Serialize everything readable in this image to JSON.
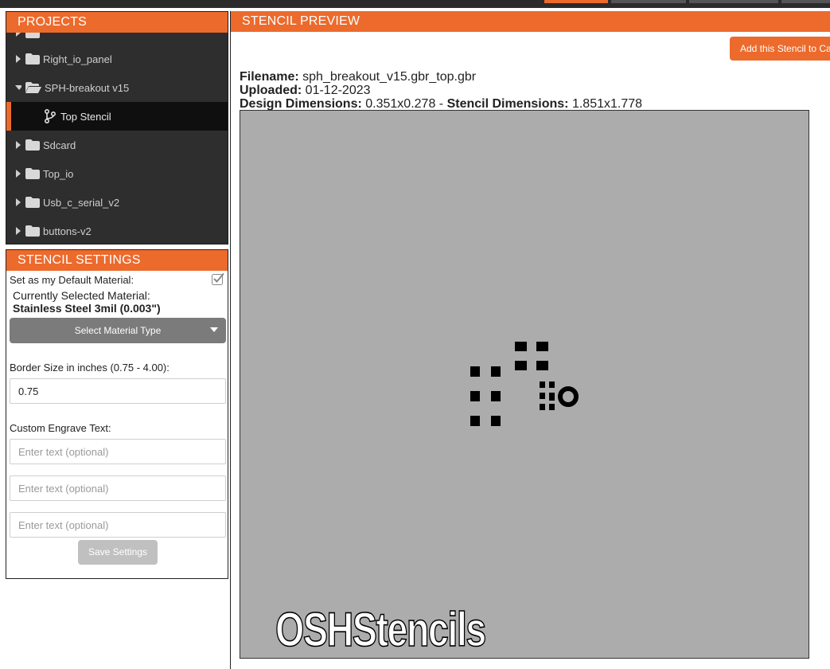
{
  "projects": {
    "title": "PROJECTS",
    "tree": [
      {
        "label": "Right_io_panel",
        "type": "folder",
        "expanded": false
      },
      {
        "label": "SPH-breakout v15",
        "type": "folder",
        "expanded": true
      },
      {
        "label": "Top Stencil",
        "type": "stencil",
        "selected": true
      },
      {
        "label": "Sdcard",
        "type": "folder",
        "expanded": false
      },
      {
        "label": "Top_io",
        "type": "folder",
        "expanded": false
      },
      {
        "label": "Usb_c_serial_v2",
        "type": "folder",
        "expanded": false
      },
      {
        "label": "buttons-v2",
        "type": "folder",
        "expanded": false
      }
    ]
  },
  "settings": {
    "title": "STENCIL SETTINGS",
    "default_material_label": "Set as my Default Material:",
    "default_material_checked": true,
    "current_material_label": "Currently Selected Material:",
    "current_material_value": "Stainless Steel 3mil (0.003\")",
    "select_material_label": "Select Material Type",
    "border_label": "Border Size in inches (0.75 - 4.00):",
    "border_value": "0.75",
    "engrave_label": "Custom Engrave Text:",
    "engrave_placeholder": "Enter text (optional)",
    "save_label": "Save Settings"
  },
  "preview": {
    "title": "STENCIL PREVIEW",
    "add_button_label": "Add this Stencil to Ca",
    "filename_label": "Filename:",
    "filename_value": "sph_breakout_v15.gbr_top.gbr",
    "uploaded_label": "Uploaded:",
    "uploaded_value": "01-12-2023",
    "design_dim_label": "Design Dimensions:",
    "design_dim_value": "0.351x0.278",
    "separator": "-",
    "stencil_dim_label": "Stencil Dimensions:",
    "stencil_dim_value": "1.851x1.778",
    "engraving_text": "OSHStencils"
  },
  "colors": {
    "accent": "#ec6a2c",
    "tree_bg": "#2e2e2e",
    "stencil_bg": "#acacac"
  }
}
